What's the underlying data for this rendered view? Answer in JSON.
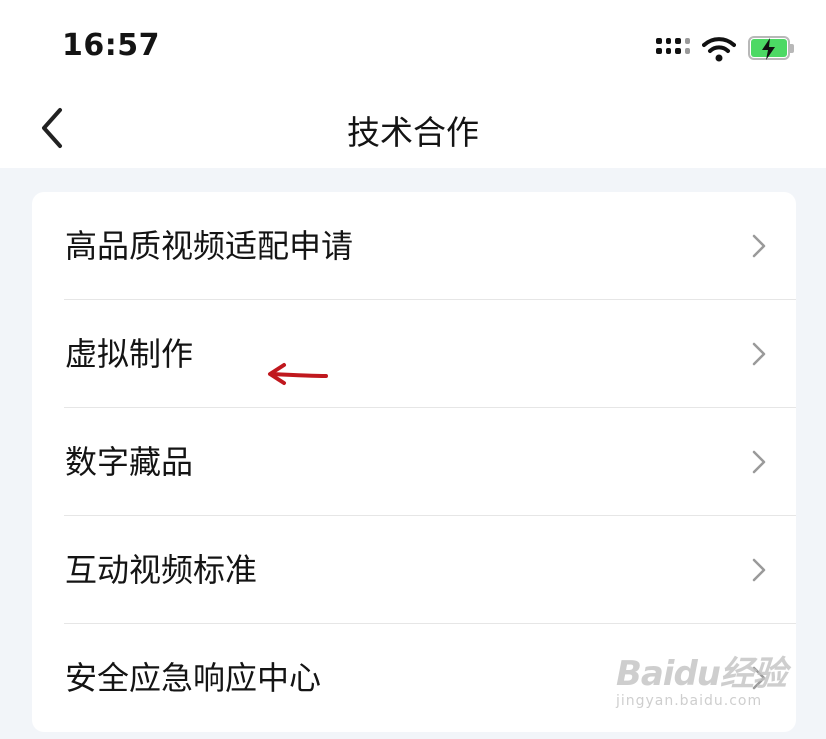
{
  "status_bar": {
    "time": "16:57"
  },
  "nav": {
    "title": "技术合作"
  },
  "menu": {
    "items": [
      {
        "label": "高品质视频适配申请"
      },
      {
        "label": "虚拟制作"
      },
      {
        "label": "数字藏品"
      },
      {
        "label": "互动视频标准"
      },
      {
        "label": "安全应急响应中心"
      }
    ]
  },
  "annotation": {
    "arrow_color": "#c0181e"
  },
  "watermark": {
    "brand": "Baidu经验",
    "url": "jingyan.baidu.com"
  },
  "colors": {
    "page_bg": "#f2f5f9",
    "card_bg": "#ffffff",
    "battery": "#4cd964"
  }
}
